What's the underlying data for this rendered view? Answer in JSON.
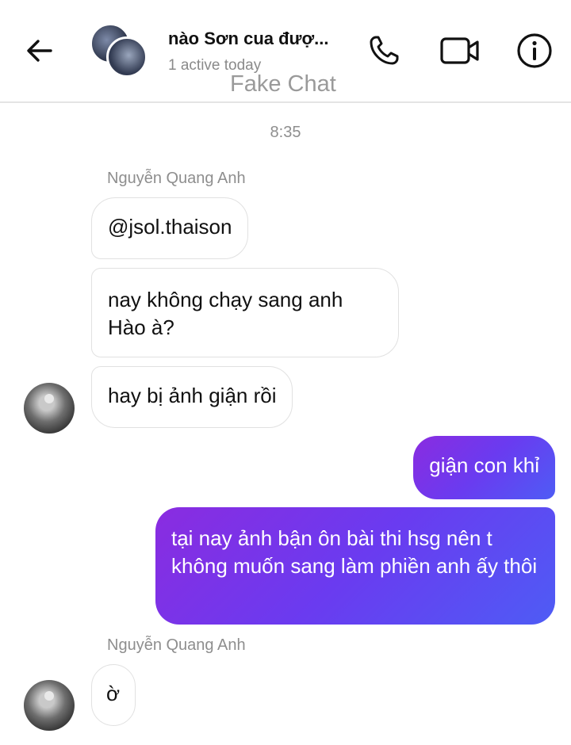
{
  "header": {
    "title": "nào Sơn cua đượ...",
    "subtitle": "1 active today",
    "watermark": "Fake Chat",
    "icons": [
      "back-arrow-icon",
      "phone-icon",
      "video-camera-icon",
      "info-icon"
    ]
  },
  "chat": {
    "timestamp": "8:35",
    "sender_name_1": "Nguyễn Quang Anh",
    "sender_name_2": "Nguyễn Quang Anh",
    "messages": [
      {
        "from": "them",
        "text": "@jsol.thaison"
      },
      {
        "from": "them",
        "text": "nay không chạy sang anh Hào à?"
      },
      {
        "from": "them",
        "text": "hay bị ảnh giận rồi"
      },
      {
        "from": "me",
        "text": "giận con khỉ"
      },
      {
        "from": "me",
        "text": "tại nay ảnh bận ôn bài thi hsg nên t không muốn sang làm phiền anh ấy thôi"
      },
      {
        "from": "them",
        "text": "ờ"
      }
    ]
  },
  "colors": {
    "outgoing_gradient": [
      "#8a2ce0",
      "#6a3bf0",
      "#4e5cf5"
    ],
    "incoming_border": "#e1e1e1",
    "muted_text": "#8e8e8e"
  }
}
